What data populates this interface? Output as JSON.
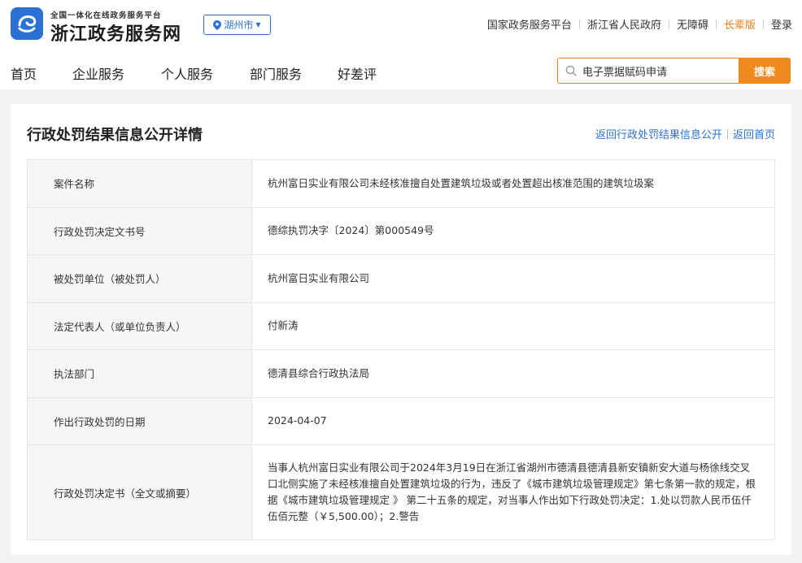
{
  "header": {
    "logo_subtitle": "全国一体化在线政务服务平台",
    "logo_title": "浙江政务服务网",
    "city": "湖州市",
    "top_links": [
      "国家政务服务平台",
      "浙江省人民政府",
      "无障碍",
      "长辈版",
      "登录"
    ]
  },
  "nav": {
    "items": [
      "首页",
      "企业服务",
      "个人服务",
      "部门服务",
      "好差评"
    ]
  },
  "search": {
    "value": "电子票据赋码申请",
    "button_label": "搜索"
  },
  "detail": {
    "title": "行政处罚结果信息公开详情",
    "back_list_label": "返回行政处罚结果信息公开",
    "back_home_label": "返回首页",
    "rows": [
      {
        "label": "案件名称",
        "value": "杭州富日实业有限公司未经核准擅自处置建筑垃圾或者处置超出核准范围的建筑垃圾案"
      },
      {
        "label": "行政处罚决定文书号",
        "value": "德综执罚决字〔2024〕第000549号"
      },
      {
        "label": "被处罚单位（被处罚人）",
        "value": "杭州富日实业有限公司"
      },
      {
        "label": "法定代表人（或单位负责人）",
        "value": "付新涛"
      },
      {
        "label": "执法部门",
        "value": "德清县综合行政执法局"
      },
      {
        "label": "作出行政处罚的日期",
        "value": "2024-04-07"
      },
      {
        "label": "行政处罚决定书（全文或摘要）",
        "value": "当事人杭州富日实业有限公司于2024年3月19日在浙江省湖州市德清县德清县新安镇新安大道与杨徐线交叉口北侧实施了未经核准擅自处置建筑垃圾的行为，违反了《城市建筑垃圾管理规定》第七条第一款的规定，根据《城市建筑垃圾管理规定 》 第二十五条的规定，对当事人作出如下行政处罚决定：1.处以罚款人民币伍仟伍佰元整（￥5,500.00）；2.警告"
      }
    ]
  },
  "colors": {
    "brand_blue": "#2b71d4",
    "accent_orange": "#f08a1d",
    "page_bg": "#f2f2f2"
  }
}
